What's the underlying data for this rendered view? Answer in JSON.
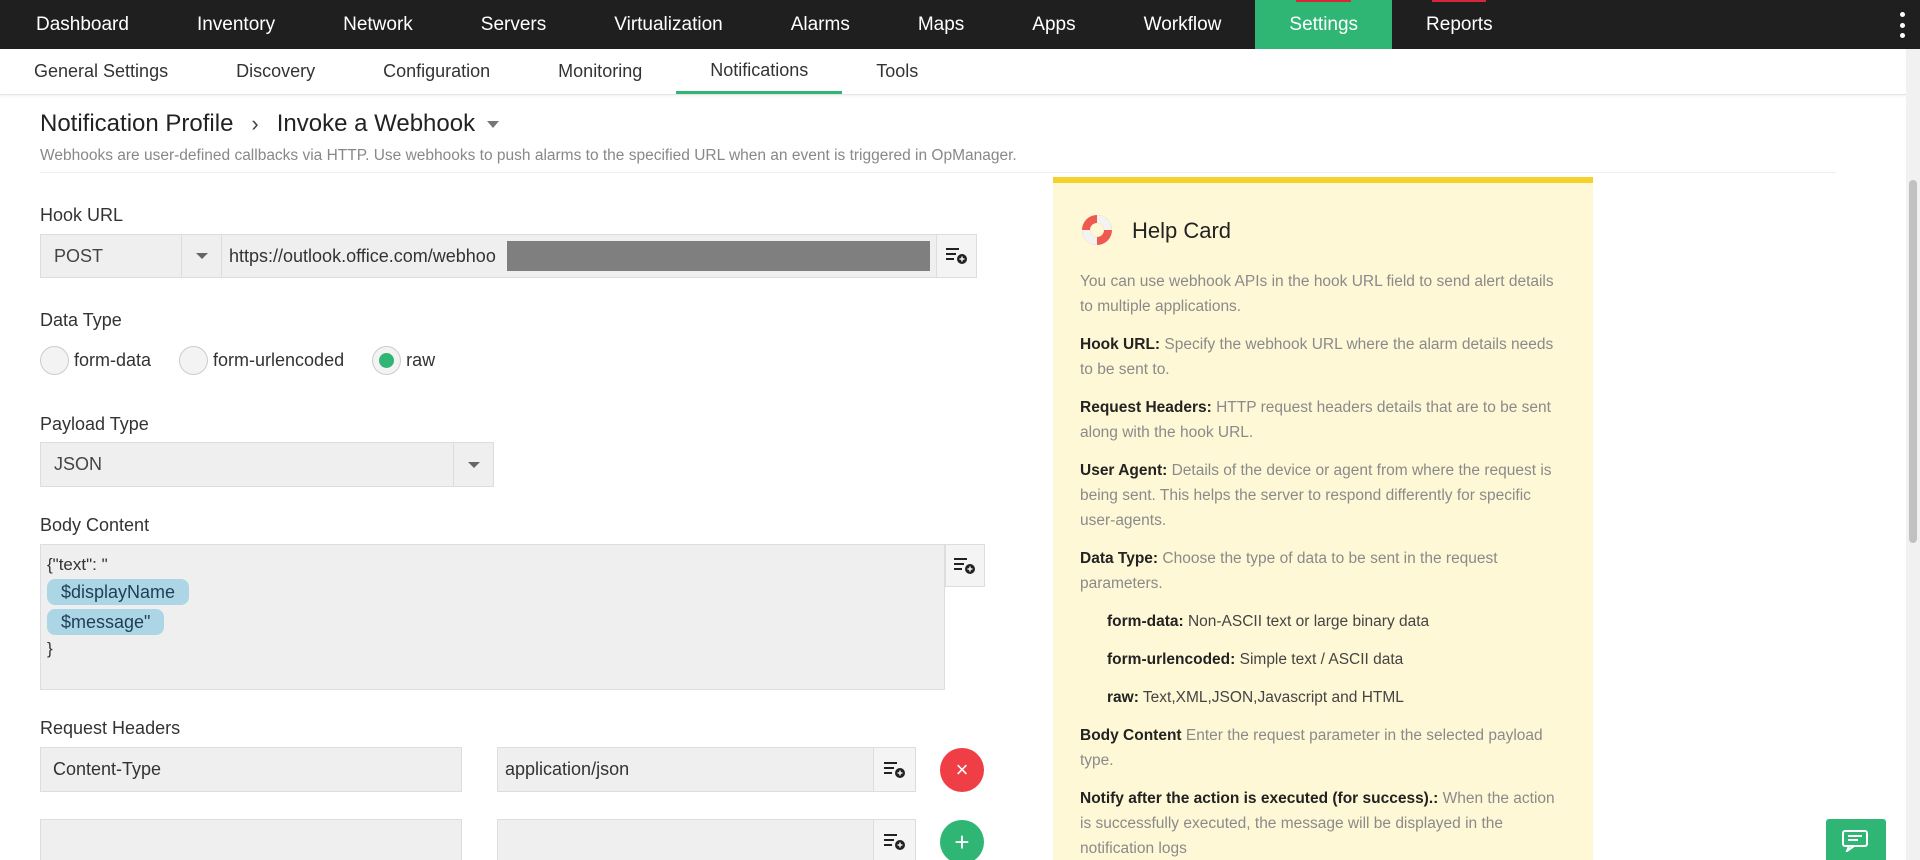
{
  "topnav": {
    "items": [
      "Dashboard",
      "Inventory",
      "Network",
      "Servers",
      "Virtualization",
      "Alarms",
      "Maps",
      "Apps",
      "Workflow",
      "Settings",
      "Reports"
    ],
    "active": "Settings",
    "accent_color": "#2fb574"
  },
  "subnav": {
    "items": [
      "General Settings",
      "Discovery",
      "Configuration",
      "Monitoring",
      "Notifications",
      "Tools"
    ],
    "active": "Notifications"
  },
  "header": {
    "breadcrumb_parent": "Notification Profile",
    "breadcrumb_sep": "›",
    "title": "Invoke a Webhook",
    "description": "Webhooks are user-defined callbacks via HTTP. Use webhooks to push alarms to the specified URL when an event is triggered in OpManager."
  },
  "form": {
    "hook_url_label": "Hook URL",
    "method": "POST",
    "url_value": "https://outlook.office.com/webhoo",
    "data_type_label": "Data Type",
    "data_types": [
      "form-data",
      "form-urlencoded",
      "raw"
    ],
    "data_type_selected": "raw",
    "payload_type_label": "Payload Type",
    "payload_type": "JSON",
    "body_label": "Body Content",
    "body_line1": "{\"text\": \"",
    "body_token1": "$displayName",
    "body_token2": "$message\"",
    "body_line_end": "}",
    "request_headers_label": "Request Headers",
    "headers": [
      {
        "key": "Content-Type",
        "value": "application/json"
      },
      {
        "key": "",
        "value": ""
      }
    ],
    "remove_icon": "×",
    "add_icon": "+"
  },
  "help": {
    "title": "Help Card",
    "intro": "You can use webhook APIs in the hook URL field to send alert details to multiple applications.",
    "hook_url_term": "Hook URL:",
    "hook_url_desc": " Specify the webhook URL where the alarm details needs to be sent to.",
    "req_headers_term": "Request Headers:",
    "req_headers_desc": " HTTP request headers details that are to be sent along with the hook URL.",
    "user_agent_term": "User Agent:",
    "user_agent_desc": " Details of the device or agent from where the request is being sent. This helps the server to respond differently for specific user-agents.",
    "data_type_term": "Data Type:",
    "data_type_desc": " Choose the type of data to be sent in the request parameters.",
    "form_data_term": "form-data:",
    "form_data_desc": " Non-ASCII text or large binary data",
    "form_url_term": "form-urlencoded:",
    "form_url_desc": " Simple text / ASCII data",
    "raw_term": "raw:",
    "raw_desc": " Text,XML,JSON,Javascript and HTML",
    "body_term": "Body Content",
    "body_desc": " Enter the request parameter in the selected payload type.",
    "notify_term": "Notify after the action is executed (for success).:",
    "notify_desc": " When the action is successfully executed, the message will be displayed in the notification logs"
  }
}
